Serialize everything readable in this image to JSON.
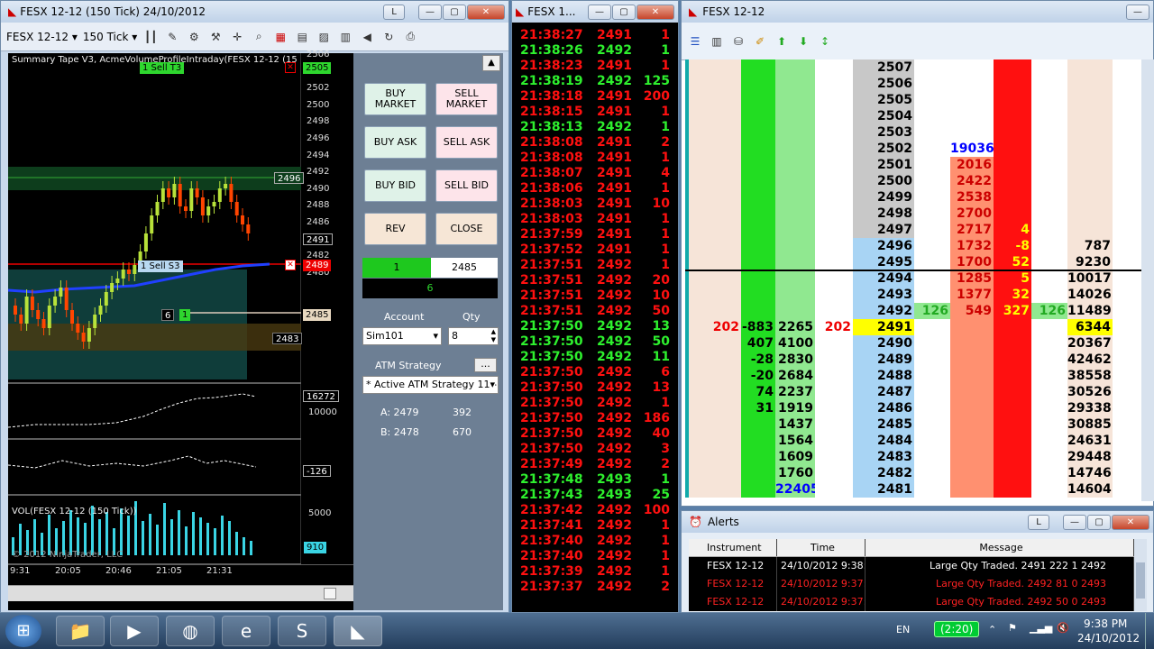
{
  "chart_window": {
    "title": "FESX 12-12 (150 Tick)  24/10/2012",
    "instrument": "FESX 12-12",
    "interval": "150 Tick",
    "btn_l": "L",
    "indicator_label": "Summary Tape V3, AcmeVolumeProfileIntraday(FESX 12-12 (15",
    "y_labels": [
      "2506",
      "2504",
      "2502",
      "2500",
      "2498",
      "2496",
      "2494",
      "2492",
      "2490",
      "2488",
      "2486",
      "2484",
      "2482",
      "2480"
    ],
    "tag_2505": "2505",
    "tag_2496": "2496",
    "tag_2491": "2491",
    "tag_2489": "2489",
    "tag_2485": "2485",
    "tag_2483": "2483",
    "sell_t3": "1  Sell T3",
    "sell_s3": "1  Sell S3",
    "pos_qty": "6",
    "pos_n": "1",
    "p2_label_1": "16272",
    "p2_label_2": "10000",
    "p3_label": "-126",
    "vol_label": "VOL(FESX 12-12 (150 Tick))",
    "vol_5000": "5000",
    "vol_910": "910",
    "copyright": "© 2012 NinjaTrader, LLC",
    "x_labels": [
      "9:31",
      "20:05",
      "20:46",
      "21:05",
      "21:31"
    ]
  },
  "order_panel": {
    "buy_market": "BUY MARKET",
    "sell_market": "SELL MARKET",
    "buy_ask": "BUY ASK",
    "sell_ask": "SELL ASK",
    "buy_bid": "BUY BID",
    "sell_bid": "SELL BID",
    "rev": "REV",
    "close": "CLOSE",
    "pos_qty": "1",
    "pos_price": "2485",
    "pnl": "6",
    "account_label": "Account",
    "qty_label": "Qty",
    "account_value": "Sim101",
    "qty_value": "8",
    "atm_label": "ATM Strategy",
    "atm_btn": "...",
    "atm_value": "* Active ATM Strategy 11 -",
    "a_label": "A: 2479",
    "a_val": "392",
    "b_label": "B: 2478",
    "b_val": "670"
  },
  "tape_window": {
    "title": "FESX 1...",
    "rows": [
      [
        "21:38:27",
        "2491",
        "1",
        "r"
      ],
      [
        "21:38:26",
        "2492",
        "1",
        "g"
      ],
      [
        "21:38:23",
        "2491",
        "1",
        "r"
      ],
      [
        "21:38:19",
        "2492",
        "125",
        "g"
      ],
      [
        "21:38:18",
        "2491",
        "200",
        "r"
      ],
      [
        "21:38:15",
        "2491",
        "1",
        "r"
      ],
      [
        "21:38:13",
        "2492",
        "1",
        "g"
      ],
      [
        "21:38:08",
        "2491",
        "2",
        "r"
      ],
      [
        "21:38:08",
        "2491",
        "1",
        "r"
      ],
      [
        "21:38:07",
        "2491",
        "4",
        "r"
      ],
      [
        "21:38:06",
        "2491",
        "1",
        "r"
      ],
      [
        "21:38:03",
        "2491",
        "10",
        "r"
      ],
      [
        "21:38:03",
        "2491",
        "1",
        "r"
      ],
      [
        "21:37:59",
        "2491",
        "1",
        "r"
      ],
      [
        "21:37:52",
        "2491",
        "1",
        "r"
      ],
      [
        "21:37:51",
        "2492",
        "1",
        "r"
      ],
      [
        "21:37:51",
        "2492",
        "20",
        "r"
      ],
      [
        "21:37:51",
        "2492",
        "10",
        "r"
      ],
      [
        "21:37:51",
        "2492",
        "50",
        "r"
      ],
      [
        "21:37:50",
        "2492",
        "13",
        "g"
      ],
      [
        "21:37:50",
        "2492",
        "50",
        "g"
      ],
      [
        "21:37:50",
        "2492",
        "11",
        "g"
      ],
      [
        "21:37:50",
        "2492",
        "6",
        "r"
      ],
      [
        "21:37:50",
        "2492",
        "13",
        "r"
      ],
      [
        "21:37:50",
        "2492",
        "1",
        "r"
      ],
      [
        "21:37:50",
        "2492",
        "186",
        "r"
      ],
      [
        "21:37:50",
        "2492",
        "40",
        "r"
      ],
      [
        "21:37:50",
        "2492",
        "3",
        "r"
      ],
      [
        "21:37:49",
        "2492",
        "2",
        "r"
      ],
      [
        "21:37:48",
        "2493",
        "1",
        "g"
      ],
      [
        "21:37:43",
        "2493",
        "25",
        "g"
      ],
      [
        "21:37:42",
        "2492",
        "100",
        "r"
      ],
      [
        "21:37:41",
        "2492",
        "1",
        "r"
      ],
      [
        "21:37:40",
        "2492",
        "1",
        "r"
      ],
      [
        "21:37:40",
        "2492",
        "1",
        "r"
      ],
      [
        "21:37:39",
        "2492",
        "1",
        "r"
      ],
      [
        "21:37:37",
        "2492",
        "2",
        "r"
      ]
    ]
  },
  "dom_window": {
    "title": "FESX 12-12",
    "rows": [
      [
        "",
        "",
        "",
        "",
        "2507",
        "",
        "",
        "",
        "",
        ""
      ],
      [
        "",
        "",
        "",
        "",
        "2506",
        "",
        "",
        "",
        "",
        ""
      ],
      [
        "",
        "",
        "",
        "",
        "2505",
        "",
        "",
        "",
        "",
        ""
      ],
      [
        "",
        "",
        "",
        "",
        "2504",
        "",
        "",
        "",
        "",
        ""
      ],
      [
        "",
        "",
        "",
        "",
        "2503",
        "",
        "",
        "",
        "",
        ""
      ],
      [
        "",
        "",
        "",
        "",
        "2502",
        "",
        "19036",
        "",
        "",
        ""
      ],
      [
        "",
        "",
        "",
        "",
        "2501",
        "",
        "2016",
        "",
        "",
        ""
      ],
      [
        "",
        "",
        "",
        "",
        "2500",
        "",
        "2422",
        "",
        "",
        ""
      ],
      [
        "",
        "",
        "",
        "",
        "2499",
        "",
        "2538",
        "",
        "",
        ""
      ],
      [
        "",
        "",
        "",
        "",
        "2498",
        "",
        "2700",
        "",
        "",
        ""
      ],
      [
        "",
        "",
        "",
        "",
        "2497",
        "",
        "2717",
        "4",
        "",
        ""
      ],
      [
        "",
        "",
        "",
        "",
        "2496",
        "",
        "1732",
        "-8",
        "",
        "787"
      ],
      [
        "",
        "",
        "",
        "",
        "2495",
        "",
        "1700",
        "52",
        "",
        "9230"
      ],
      [
        "",
        "",
        "",
        "",
        "2494",
        "",
        "1285",
        "5",
        "",
        "10017"
      ],
      [
        "",
        "",
        "",
        "",
        "2493",
        "",
        "1377",
        "32",
        "",
        "14026"
      ],
      [
        "",
        "",
        "",
        "",
        "2492",
        "126",
        "549",
        "327",
        "126",
        "11489"
      ],
      [
        "202",
        "-883",
        "2265",
        "202",
        "2491",
        "",
        "",
        "",
        "",
        "6344"
      ],
      [
        "",
        "407",
        "4100",
        "",
        "2490",
        "",
        "",
        "",
        "",
        "20367"
      ],
      [
        "",
        "-28",
        "2830",
        "",
        "2489",
        "",
        "",
        "",
        "",
        "42462"
      ],
      [
        "",
        "-20",
        "2684",
        "",
        "2488",
        "",
        "",
        "",
        "",
        "38558"
      ],
      [
        "",
        "74",
        "2237",
        "",
        "2487",
        "",
        "",
        "",
        "",
        "30526"
      ],
      [
        "",
        "31",
        "1919",
        "",
        "2486",
        "",
        "",
        "",
        "",
        "29338"
      ],
      [
        "",
        "",
        "1437",
        "",
        "2485",
        "",
        "",
        "",
        "",
        "30885"
      ],
      [
        "",
        "",
        "1564",
        "",
        "2484",
        "",
        "",
        "",
        "",
        "24631"
      ],
      [
        "",
        "",
        "1609",
        "",
        "2483",
        "",
        "",
        "",
        "",
        "29448"
      ],
      [
        "",
        "",
        "1760",
        "",
        "2482",
        "",
        "",
        "",
        "",
        "14746"
      ],
      [
        "",
        "",
        "22405",
        "",
        "2481",
        "",
        "",
        "",
        "",
        "14604"
      ]
    ]
  },
  "alerts_window": {
    "title": "Alerts",
    "btn_l": "L",
    "headers": [
      "Instrument",
      "Time",
      "Message"
    ],
    "rows": [
      [
        "FESX 12-12",
        "24/10/2012 9:38:",
        "Large Qty Traded.  2491  222    1  2492"
      ],
      [
        "FESX 12-12",
        "24/10/2012 9:37:",
        "Large Qty Traded.  2492  81    0  2493"
      ],
      [
        "FESX 12-12",
        "24/10/2012 9:37:",
        "Large Qty Traded.  2492  50    0  2493"
      ]
    ]
  },
  "taskbar": {
    "lang": "EN",
    "battery": "(2:20)",
    "time": "9:38 PM",
    "date": "24/10/2012"
  },
  "colors": {
    "bid_green": "#00e000",
    "ask_red": "#ff0000",
    "price_gray": "#c0c0c0"
  }
}
